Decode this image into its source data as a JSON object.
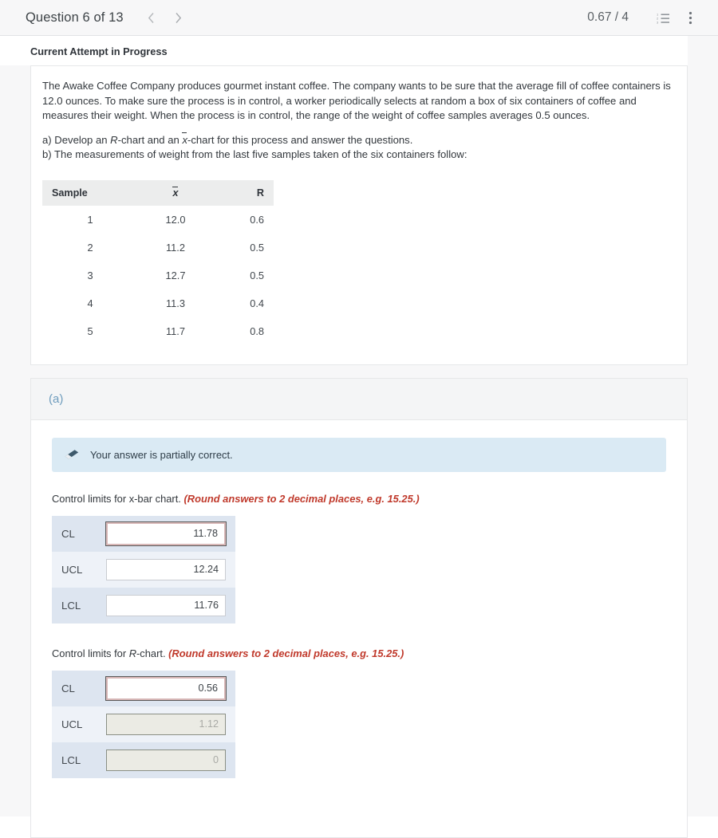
{
  "header": {
    "question_title": "Question 6 of 13",
    "prev_icon": "chevron-left-icon",
    "next_icon": "chevron-right-icon",
    "score": "0.67 / 4",
    "list_icon": "numbered-list-icon",
    "menu_icon": "kebab-menu-icon"
  },
  "attempt": {
    "status": "Current Attempt in Progress"
  },
  "question": {
    "paragraph1": "The Awake Coffee Company produces gourmet instant coffee. The company wants to be sure that the average fill of coffee containers is 12.0 ounces. To make sure the process is in control, a worker periodically selects at random a box of six containers of coffee and measures their weight. When the process is in control, the range of the weight of coffee samples averages 0.5 ounces.",
    "part_a_prefix": "a) Develop an ",
    "part_a_mid": "-chart and an ",
    "part_a_xbar": "x",
    "part_a_rchar": "R",
    "part_a_suffix": "-chart for this process and answer the questions.",
    "part_b": "b) The measurements of weight from the last five samples taken of the six containers follow:"
  },
  "table": {
    "headers": {
      "sample": "Sample",
      "xbar": "x",
      "range": "R"
    },
    "rows": [
      {
        "sample": "1",
        "xbar": "12.0",
        "range": "0.6"
      },
      {
        "sample": "2",
        "xbar": "11.2",
        "range": "0.5"
      },
      {
        "sample": "3",
        "xbar": "12.7",
        "range": "0.5"
      },
      {
        "sample": "4",
        "xbar": "11.3",
        "range": "0.4"
      },
      {
        "sample": "5",
        "xbar": "11.7",
        "range": "0.8"
      }
    ]
  },
  "part_a": {
    "label": "(a)",
    "feedback": {
      "icon": "eraser-icon",
      "text": "Your answer is partially correct."
    },
    "xbar_section": {
      "prompt": "Control limits for x-bar chart. ",
      "hint": "(Round answers to 2 decimal places, e.g. 15.25.)",
      "fields": [
        {
          "label": "CL",
          "value": "11.78",
          "state": "error"
        },
        {
          "label": "UCL",
          "value": "12.24",
          "state": "normal"
        },
        {
          "label": "LCL",
          "value": "11.76",
          "state": "normal"
        }
      ]
    },
    "rchart_section": {
      "prompt_pre": "Control limits for ",
      "prompt_r": "R",
      "prompt_post": "-chart. ",
      "hint": "(Round answers to 2 decimal places, e.g. 15.25.)",
      "fields": [
        {
          "label": "CL",
          "value": "0.56",
          "state": "error"
        },
        {
          "label": "UCL",
          "value": "1.12",
          "state": "disabled"
        },
        {
          "label": "LCL",
          "value": "0",
          "state": "disabled"
        }
      ]
    }
  },
  "colors": {
    "accent_blue": "#6e9cbd",
    "alert_bg": "#daeaf4",
    "hint_red": "#c0392b",
    "row_odd": "#dde5f0",
    "row_even": "#eef2f8"
  }
}
